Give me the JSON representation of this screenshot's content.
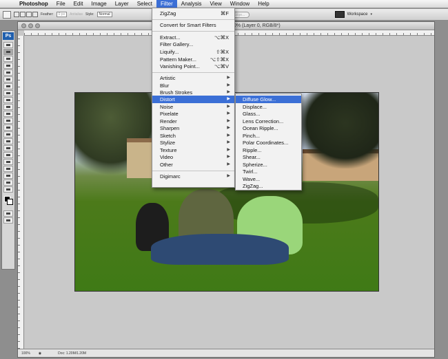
{
  "menubar": {
    "items": [
      "Photoshop",
      "File",
      "Edit",
      "Image",
      "Layer",
      "Select",
      "Filter",
      "Analysis",
      "View",
      "Window",
      "Help"
    ],
    "active": "Filter"
  },
  "options_bar": {
    "feather_label": "Feather:",
    "feather_value": "0 px",
    "antialias_label": "Antialias",
    "style_label": "Style:",
    "style_value": "Normal",
    "refine_edge": "Refine Edge...",
    "workspace": "Workspace"
  },
  "document": {
    "title_fragment": "0% (Layer 0, RGB/8*)",
    "zoom": "100%",
    "doc_size": "Doc: 1.20M/1.20M"
  },
  "filter_menu": {
    "last_filter": "ZigZag",
    "last_filter_shortcut": "⌘F",
    "convert_smart": "Convert for Smart Filters",
    "group1": [
      {
        "label": "Extract...",
        "shortcut": "⌥⌘X"
      },
      {
        "label": "Filter Gallery...",
        "shortcut": ""
      },
      {
        "label": "Liquify...",
        "shortcut": "⇧⌘X"
      },
      {
        "label": "Pattern Maker...",
        "shortcut": "⌥⇧⌘X"
      },
      {
        "label": "Vanishing Point...",
        "shortcut": "⌥⌘V"
      }
    ],
    "submenus": [
      "Artistic",
      "Blur",
      "Brush Strokes",
      "Distort",
      "Noise",
      "Pixelate",
      "Render",
      "Sharpen",
      "Sketch",
      "Stylize",
      "Texture",
      "Video",
      "Other"
    ],
    "highlighted": "Distort",
    "digimarc": "Digimarc"
  },
  "distort_menu": {
    "items": [
      "Diffuse Glow...",
      "Displace...",
      "Glass...",
      "Lens Correction...",
      "Ocean Ripple...",
      "Pinch...",
      "Polar Coordinates...",
      "Ripple...",
      "Shear...",
      "Spherize...",
      "Twirl...",
      "Wave...",
      "ZigZag..."
    ],
    "highlighted": "Diffuse Glow..."
  },
  "colors": {
    "menu_highlight": "#3b6fd6",
    "ps_logo": "#1f5fae"
  },
  "icons": [
    "apple-icon",
    "marquee-tool-icon",
    "photoshop-logo-icon",
    "submenu-arrow-icon"
  ]
}
